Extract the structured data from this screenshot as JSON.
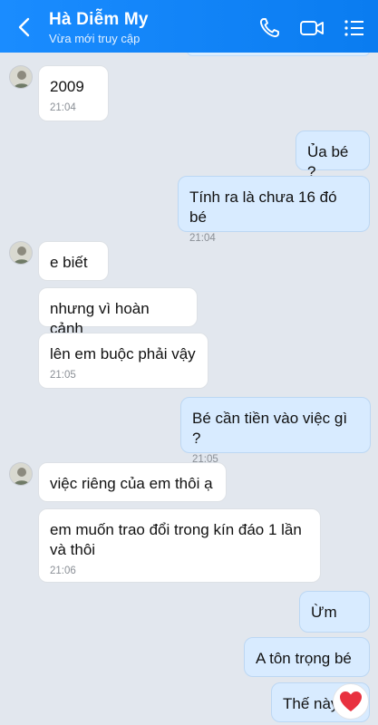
{
  "header": {
    "name": "Hà Diễm My",
    "status": "Vừa mới truy cập",
    "icons": [
      "back-arrow-icon",
      "phone-icon",
      "video-camera-icon",
      "list-menu-icon"
    ],
    "color": "#0a7cf0"
  },
  "messages": [
    {
      "from": "them",
      "text": "2009",
      "time": "21:04"
    },
    {
      "from": "me",
      "text": "Ủa bé ?"
    },
    {
      "from": "me",
      "text": "Tính ra là chưa 16 đó bé",
      "time": "21:04"
    },
    {
      "from": "them",
      "text": "e biết"
    },
    {
      "from": "them",
      "text": "nhưng vì hoàn cảnh"
    },
    {
      "from": "them",
      "text": "lên em buộc phải vậy",
      "time": "21:05"
    },
    {
      "from": "me",
      "text": "Bé cần tiền vào việc gì ?",
      "time": "21:05"
    },
    {
      "from": "them",
      "text": "việc riêng của em thôi ạ"
    },
    {
      "from": "them",
      "text": "em muốn trao đổi trong kín đáo 1 lần\nvà thôi",
      "time": "21:06"
    },
    {
      "from": "me",
      "text": "Ừm"
    },
    {
      "from": "me",
      "text": "A tôn trọng bé"
    },
    {
      "from": "me",
      "text": "Thế này"
    }
  ],
  "reaction": {
    "icon": "heart-icon",
    "color": "#e8313f"
  }
}
